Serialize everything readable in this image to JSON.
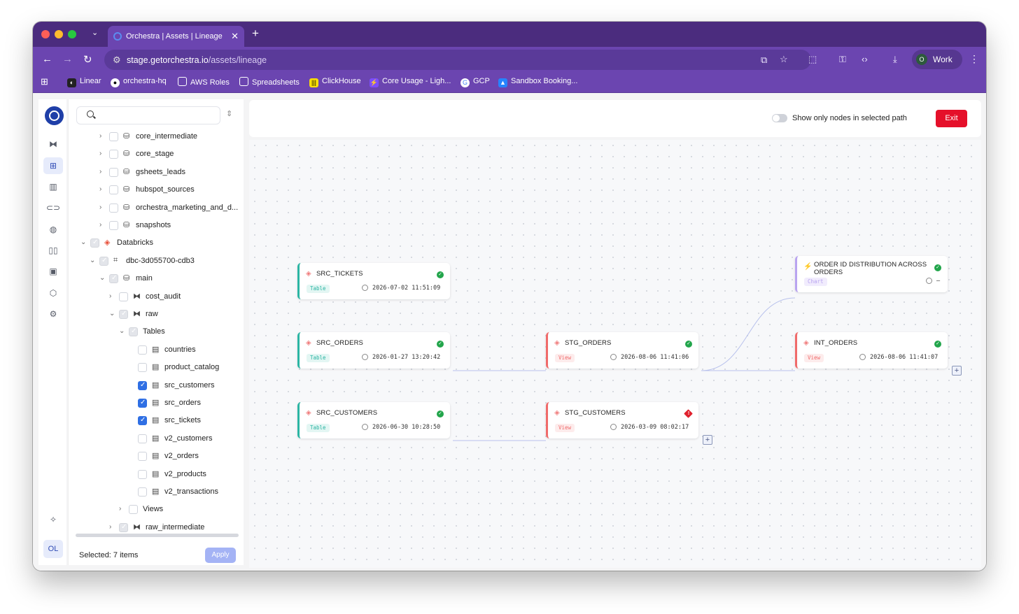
{
  "browser": {
    "tab_title": "Orchestra | Assets | Lineage",
    "url_host": "stage.getorchestra.io",
    "url_path": "/assets/lineage",
    "profile_initial": "O",
    "profile_label": "Work",
    "bookmarks": [
      "Linear",
      "orchestra-hq",
      "AWS Roles",
      "Spreadsheets",
      "ClickHouse",
      "Core Usage - Ligh...",
      "GCP",
      "Sandbox Booking..."
    ]
  },
  "sidebar": {
    "user_initials": "OL",
    "search_placeholder": "",
    "tree": [
      {
        "label": "core_intermediate",
        "level": 3,
        "icon": "database-icon",
        "check": "off",
        "chevron": "right"
      },
      {
        "label": "core_stage",
        "level": 3,
        "icon": "database-icon",
        "check": "off",
        "chevron": "right"
      },
      {
        "label": "gsheets_leads",
        "level": 3,
        "icon": "database-icon",
        "check": "off",
        "chevron": "right"
      },
      {
        "label": "hubspot_sources",
        "level": 3,
        "icon": "database-icon",
        "check": "off",
        "chevron": "right"
      },
      {
        "label": "orchestra_marketing_and_d...",
        "level": 3,
        "icon": "database-icon",
        "check": "off",
        "chevron": "right"
      },
      {
        "label": "snapshots",
        "level": 3,
        "icon": "database-icon",
        "check": "off",
        "chevron": "right"
      },
      {
        "label": "Databricks",
        "level": 1,
        "icon": "databricks-icon",
        "check": "grey",
        "chevron": "down"
      },
      {
        "label": "dbc-3d055700-cdb3",
        "level": 2,
        "icon": "workspace-icon",
        "check": "grey",
        "chevron": "down"
      },
      {
        "label": "main",
        "level": 3,
        "icon": "database-icon",
        "check": "grey",
        "chevron": "down"
      },
      {
        "label": "cost_audit",
        "level": 4,
        "icon": "schema-icon",
        "check": "off",
        "chevron": "right"
      },
      {
        "label": "raw",
        "level": 4,
        "icon": "schema-icon",
        "check": "grey",
        "chevron": "down"
      },
      {
        "label": "Tables",
        "level": 5,
        "icon": "",
        "check": "grey",
        "chevron": "down"
      },
      {
        "label": "countries",
        "level": 6,
        "icon": "table-icon",
        "check": "off",
        "chevron": ""
      },
      {
        "label": "product_catalog",
        "level": 6,
        "icon": "table-icon",
        "check": "off",
        "chevron": ""
      },
      {
        "label": "src_customers",
        "level": 6,
        "icon": "table-icon",
        "check": "on",
        "chevron": ""
      },
      {
        "label": "src_orders",
        "level": 6,
        "icon": "table-icon",
        "check": "on",
        "chevron": ""
      },
      {
        "label": "src_tickets",
        "level": 6,
        "icon": "table-icon",
        "check": "on",
        "chevron": ""
      },
      {
        "label": "v2_customers",
        "level": 6,
        "icon": "table-icon",
        "check": "off",
        "chevron": ""
      },
      {
        "label": "v2_orders",
        "level": 6,
        "icon": "table-icon",
        "check": "off",
        "chevron": ""
      },
      {
        "label": "v2_products",
        "level": 6,
        "icon": "table-icon",
        "check": "off",
        "chevron": ""
      },
      {
        "label": "v2_transactions",
        "level": 6,
        "icon": "table-icon",
        "check": "off",
        "chevron": ""
      },
      {
        "label": "Views",
        "level": 5,
        "icon": "",
        "check": "off",
        "chevron": "right"
      },
      {
        "label": "raw_intermediate",
        "level": 4,
        "icon": "schema-icon",
        "check": "grey",
        "chevron": "right"
      }
    ],
    "selected_text": "Selected: 7 items",
    "apply_label": "Apply"
  },
  "header": {
    "toggle_label": "Show only nodes in selected path",
    "exit_label": "Exit"
  },
  "lineage": {
    "nodes": [
      {
        "id": "src_tickets",
        "name": "SRC_TICKETS",
        "kind": "table",
        "badge": "Table",
        "timestamp": "2026-07-02 11:51:09",
        "status": "ok"
      },
      {
        "id": "src_orders",
        "name": "SRC_ORDERS",
        "kind": "table",
        "badge": "Table",
        "timestamp": "2026-01-27 13:20:42",
        "status": "ok"
      },
      {
        "id": "src_customers",
        "name": "SRC_CUSTOMERS",
        "kind": "table",
        "badge": "Table",
        "timestamp": "2026-06-30 10:28:50",
        "status": "ok"
      },
      {
        "id": "stg_orders",
        "name": "STG_ORDERS",
        "kind": "view",
        "badge": "View",
        "timestamp": "2026-08-06 11:41:06",
        "status": "ok"
      },
      {
        "id": "stg_customers",
        "name": "STG_CUSTOMERS",
        "kind": "view",
        "badge": "View",
        "timestamp": "2026-03-09 08:02:17",
        "status": "error"
      },
      {
        "id": "order_chart",
        "name": "ORDER ID DISTRIBUTION ACROSS ORDERS",
        "kind": "chart",
        "badge": "Chart",
        "timestamp": "–",
        "status": "ok"
      },
      {
        "id": "int_orders",
        "name": "INT_ORDERS",
        "kind": "view",
        "badge": "View",
        "timestamp": "2026-08-06 11:41:07",
        "status": "ok"
      }
    ],
    "colors": {
      "table": "#2bb5a3",
      "view": "#f06a6a",
      "chart": "#b9a4f0",
      "ok": "#22a54b",
      "error": "#e0212e",
      "exit": "#e5102a",
      "brand": "#6b45b0"
    }
  }
}
